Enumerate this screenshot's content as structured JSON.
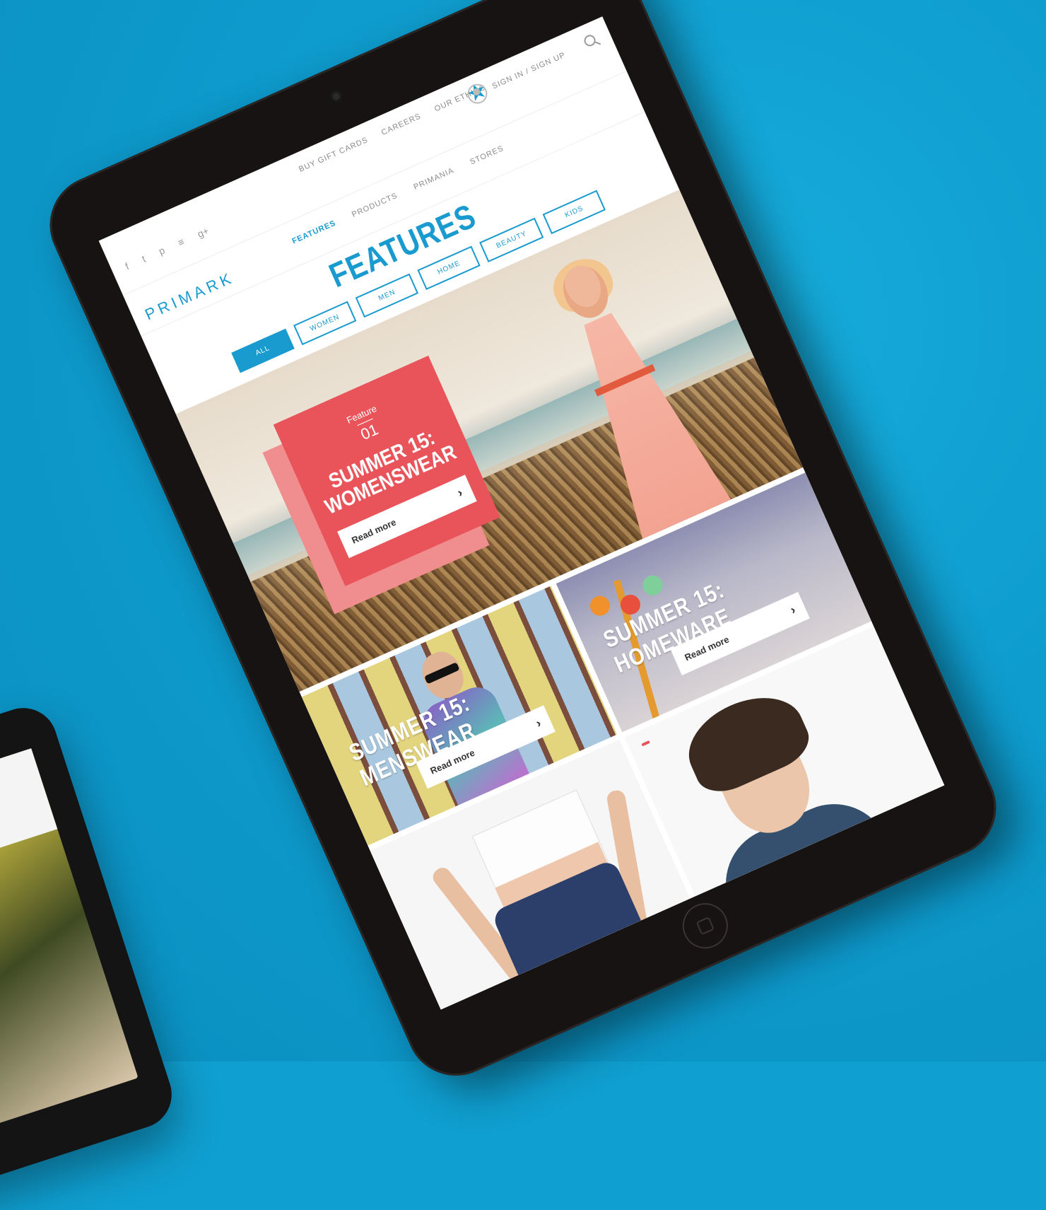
{
  "header": {
    "utility_links": [
      "BUY GIFT CARDS",
      "CAREERS",
      "OUR ETHICS"
    ],
    "signin_label": "SIGN IN / SIGN UP",
    "social_icons": [
      "facebook-icon",
      "twitter-icon",
      "pinterest-icon",
      "blog-icon",
      "google-plus-icon"
    ],
    "logo": "PRIMARK",
    "main_nav": [
      "FEATURES",
      "PRODUCTS",
      "PRIMANIA",
      "STORES"
    ]
  },
  "page": {
    "title": "FEATURES",
    "filters": [
      "ALL",
      "WOMEN",
      "MEN",
      "HOME",
      "BEAUTY",
      "KIDS"
    ],
    "active_filter": "ALL"
  },
  "hero": {
    "kicker": "Feature",
    "number": "01",
    "title_line1": "SUMMER 15:",
    "title_line2": "WOMENSWEAR",
    "cta": "Read more"
  },
  "tiles": {
    "homeware": {
      "title": "SUMMER 15: HOMEWARE",
      "cta": "Read more"
    },
    "menswear": {
      "title": "SUMMER 15: MENSWEAR",
      "cta": "Read more"
    }
  },
  "colors": {
    "background": "#0f9fd0",
    "brand_blue": "#1a9bd0",
    "coral": "#e9545a"
  }
}
